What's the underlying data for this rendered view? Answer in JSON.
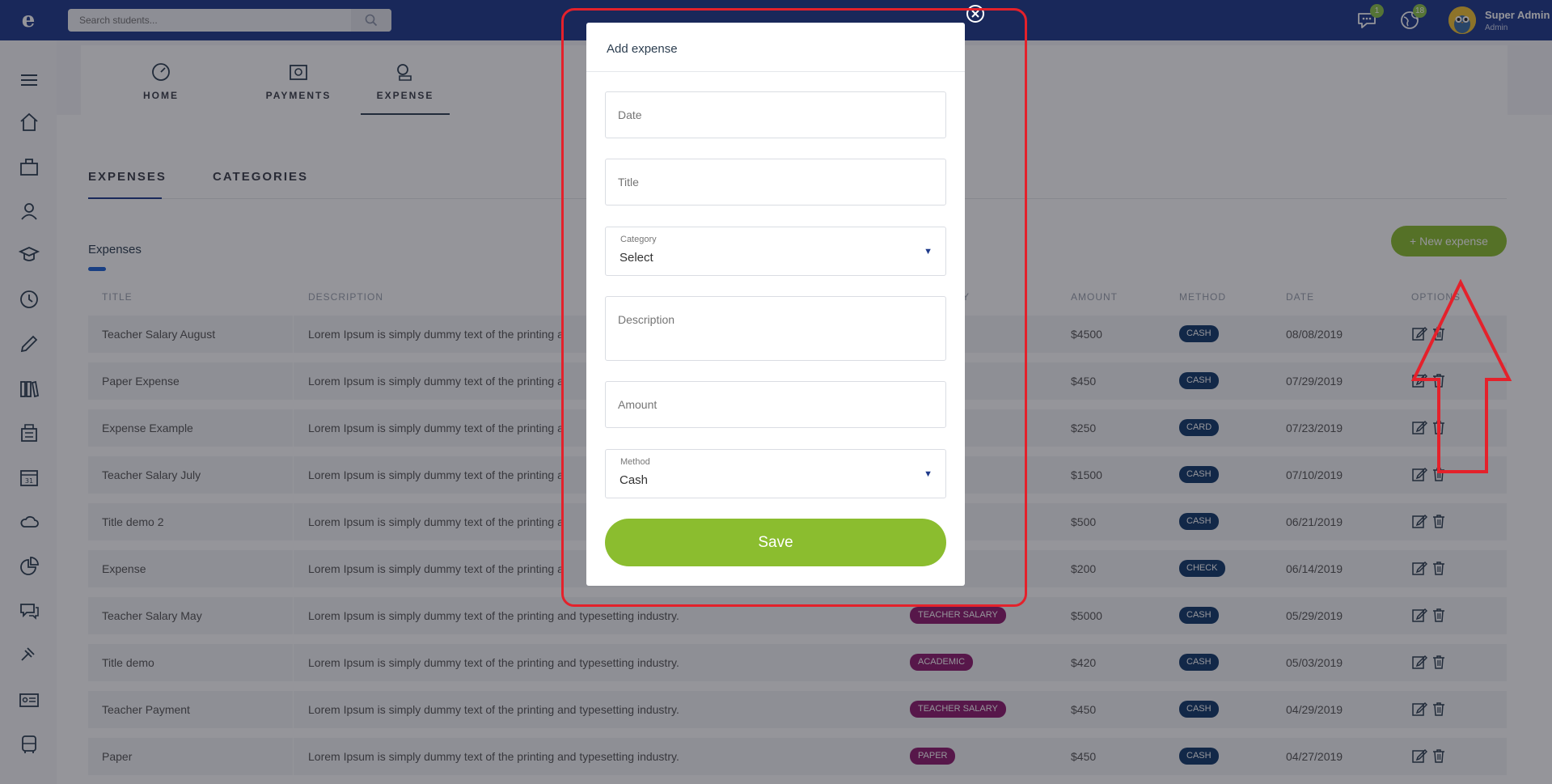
{
  "app": {
    "logo_char": "e",
    "search_placeholder": "Search students...",
    "notifications": [
      {
        "icon": "chat-icon",
        "count": "1"
      },
      {
        "icon": "globe-icon",
        "count": "18"
      }
    ],
    "user": {
      "name": "Super Admin",
      "role": "Admin"
    }
  },
  "subnav": [
    {
      "label": "HOME",
      "icon": "dashboard-icon"
    },
    {
      "label": "PAYMENTS",
      "icon": "payments-icon"
    },
    {
      "label": "EXPENSE",
      "icon": "expense-icon"
    }
  ],
  "tabs": [
    {
      "label": "EXPENSES"
    },
    {
      "label": "CATEGORIES"
    }
  ],
  "section_title": "Expenses",
  "new_expense_label": "+ New expense",
  "table": {
    "headers": {
      "title": "TITLE",
      "description": "DESCRIPTION",
      "category": "Y",
      "amount": "AMOUNT",
      "method": "METHOD",
      "date": "DATE",
      "options": "OPTIONS"
    },
    "rows": [
      {
        "title": "Teacher Salary August",
        "description": "Lorem Ipsum is simply dummy text of the printing a",
        "category": "ALARY",
        "amount": "$4500",
        "method": "CASH",
        "date": "08/08/2019"
      },
      {
        "title": "Paper Expense",
        "description": "Lorem Ipsum is simply dummy text of the printing a",
        "category": "",
        "amount": "$450",
        "method": "CASH",
        "date": "07/29/2019"
      },
      {
        "title": "Expense Example",
        "description": "Lorem Ipsum is simply dummy text of the printing a",
        "category": "",
        "amount": "$250",
        "method": "CARD",
        "date": "07/23/2019"
      },
      {
        "title": "Teacher Salary July",
        "description": "Lorem Ipsum is simply dummy text of the printing a",
        "category": "ALARY",
        "amount": "$1500",
        "method": "CASH",
        "date": "07/10/2019"
      },
      {
        "title": "Title demo 2",
        "description": "Lorem Ipsum is simply dummy text of the printing a",
        "category": "Y",
        "amount": "$500",
        "method": "CASH",
        "date": "06/21/2019"
      },
      {
        "title": "Expense",
        "description": "Lorem Ipsum is simply dummy text of the printing a",
        "category": "",
        "amount": "$200",
        "method": "CHECK",
        "date": "06/14/2019"
      },
      {
        "title": "Teacher Salary May",
        "description": "Lorem Ipsum is simply dummy text of the printing and typesetting industry.",
        "category": "TEACHER SALARY",
        "amount": "$5000",
        "method": "CASH",
        "date": "05/29/2019"
      },
      {
        "title": "Title demo",
        "description": "Lorem Ipsum is simply dummy text of the printing and typesetting industry.",
        "category": "ACADEMIC",
        "amount": "$420",
        "method": "CASH",
        "date": "05/03/2019"
      },
      {
        "title": "Teacher Payment",
        "description": "Lorem Ipsum is simply dummy text of the printing and typesetting industry.",
        "category": "TEACHER SALARY",
        "amount": "$450",
        "method": "CASH",
        "date": "04/29/2019"
      },
      {
        "title": "Paper",
        "description": "Lorem Ipsum is simply dummy text of the printing and typesetting industry.",
        "category": "PAPER",
        "amount": "$450",
        "method": "CASH",
        "date": "04/27/2019"
      }
    ]
  },
  "modal": {
    "title": "Add expense",
    "date_placeholder": "Date",
    "title_placeholder": "Title",
    "category_label": "Category",
    "category_value": "Select",
    "description_placeholder": "Description",
    "amount_placeholder": "Amount",
    "method_label": "Method",
    "method_value": "Cash",
    "save_label": "Save"
  },
  "colors": {
    "topbar": "#1e3a8a",
    "accent_green": "#8bbd2f",
    "category_badge": "#8e1b6e",
    "method_badge": "#123a6b",
    "annotation_red": "#e4212b"
  }
}
